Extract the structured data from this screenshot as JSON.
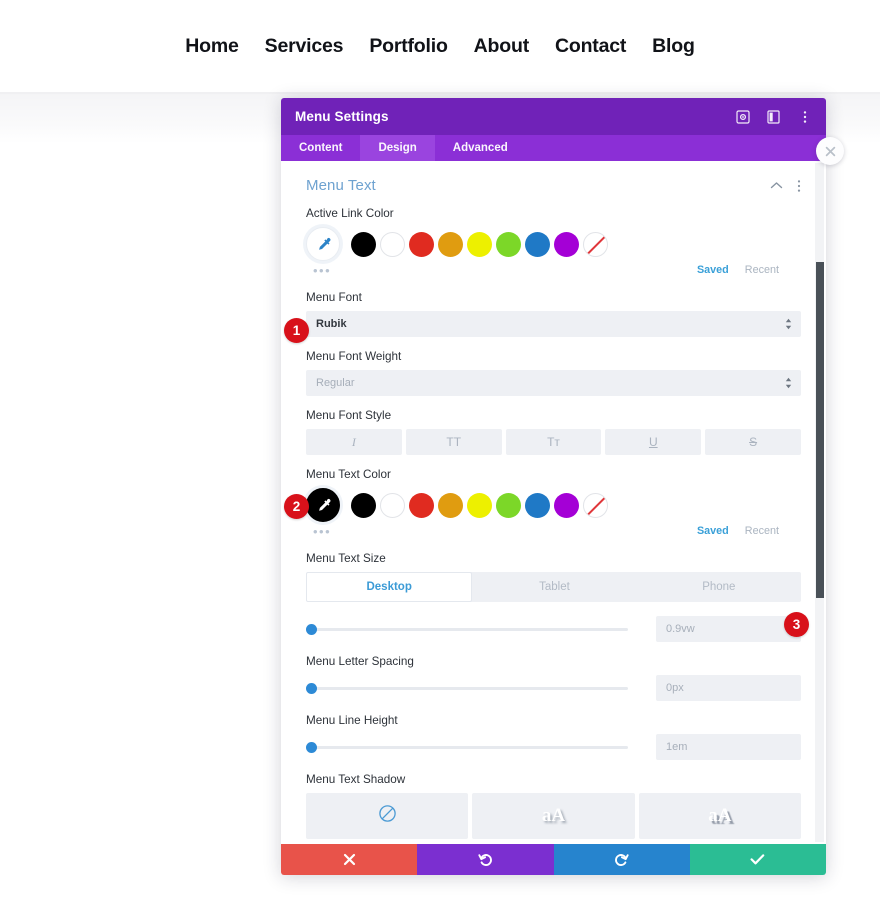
{
  "site_nav": {
    "items": [
      {
        "label": "Home"
      },
      {
        "label": "Services"
      },
      {
        "label": "Portfolio"
      },
      {
        "label": "About"
      },
      {
        "label": "Contact"
      },
      {
        "label": "Blog"
      }
    ]
  },
  "modal": {
    "title": "Menu Settings",
    "header_icons": [
      {
        "name": "target-icon"
      },
      {
        "name": "layout-panel-icon"
      },
      {
        "name": "more-vertical-icon"
      }
    ],
    "tabs": [
      {
        "label": "Content",
        "active": false
      },
      {
        "label": "Design",
        "active": true
      },
      {
        "label": "Advanced",
        "active": false
      }
    ],
    "close_label": "×"
  },
  "section": {
    "title": "Menu Text",
    "collapse_icon": "chevron-up-icon",
    "more_icon": "more-vertical-icon"
  },
  "palette": {
    "colors": [
      "#000000",
      "#ffffff",
      "#e02b20",
      "#e09c10",
      "#edf000",
      "#7cd728",
      "#1f79c6",
      "#a400d6"
    ],
    "transparent_label": "transparent",
    "saved_label": "Saved",
    "recent_label": "Recent",
    "more_dots": "•••"
  },
  "fields": {
    "active_link_color": {
      "label": "Active Link Color"
    },
    "menu_font": {
      "label": "Menu Font",
      "value": "Rubik"
    },
    "menu_font_weight": {
      "label": "Menu Font Weight",
      "value": "Regular"
    },
    "menu_font_style": {
      "label": "Menu Font Style",
      "buttons": [
        {
          "glyph": "I",
          "name": "italic"
        },
        {
          "glyph": "TT",
          "name": "uppercase"
        },
        {
          "glyph": "Tт",
          "name": "small-caps"
        },
        {
          "glyph": "U",
          "name": "underline"
        },
        {
          "glyph": "S",
          "name": "strikethrough"
        }
      ]
    },
    "menu_text_color": {
      "label": "Menu Text Color"
    },
    "menu_text_size": {
      "label": "Menu Text Size",
      "value": "0.9vw",
      "devices": [
        {
          "label": "Desktop",
          "active": true
        },
        {
          "label": "Tablet",
          "active": false
        },
        {
          "label": "Phone",
          "active": false
        }
      ]
    },
    "menu_letter_spacing": {
      "label": "Menu Letter Spacing",
      "value": "0px"
    },
    "menu_line_height": {
      "label": "Menu Line Height",
      "value": "1em"
    },
    "menu_text_shadow": {
      "label": "Menu Text Shadow",
      "options": [
        {
          "glyph": "",
          "name": "no-shadow",
          "selected": true
        },
        {
          "glyph": "aA",
          "name": "shadow-soft",
          "selected": false
        },
        {
          "glyph": "aA",
          "name": "shadow-hard",
          "selected": false
        }
      ]
    }
  },
  "actions": [
    {
      "name": "cancel",
      "icon": "close-icon",
      "color": "#e8534a"
    },
    {
      "name": "undo",
      "icon": "undo-icon",
      "color": "#7b2fd0"
    },
    {
      "name": "redo",
      "icon": "redo-icon",
      "color": "#2684ce"
    },
    {
      "name": "save",
      "icon": "check-icon",
      "color": "#2bbd94"
    }
  ],
  "badges": [
    {
      "number": "1"
    },
    {
      "number": "2"
    },
    {
      "number": "3"
    }
  ]
}
